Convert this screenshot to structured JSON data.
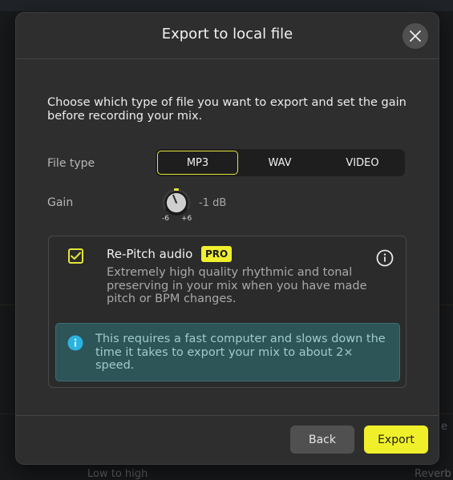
{
  "dialog": {
    "title": "Export to local file",
    "description": "Choose which type of file you want to export and set the gain before recording your mix."
  },
  "file_type": {
    "label": "File type",
    "options": [
      "MP3",
      "WAV",
      "VIDEO"
    ],
    "selected": "MP3"
  },
  "gain": {
    "label": "Gain",
    "min_label": "-6",
    "max_label": "+6",
    "value_label": "-1 dB",
    "value_db": -1
  },
  "repitch": {
    "title": "Re-Pitch audio",
    "badge": "PRO",
    "checked": true,
    "description": "Extremely high quality rhythmic and tonal preserving in your mix when you have made pitch or BPM changes.",
    "notice": "This requires a fast computer and slows down the time it takes to export your mix to about 2× speed."
  },
  "footer": {
    "back_label": "Back",
    "export_label": "Export"
  },
  "background": {
    "left_text": "Low to high",
    "right_text": "Reverb",
    "edge_text": "e"
  },
  "colors": {
    "accent": "#f0f02a",
    "notice_bg": "#2d5457",
    "modal_bg": "#2e2e2e"
  },
  "icons": {
    "close": "close-icon",
    "checkbox": "checkmark-icon",
    "info": "info-icon",
    "notice": "info-circle-icon",
    "knob": "gain-knob"
  }
}
